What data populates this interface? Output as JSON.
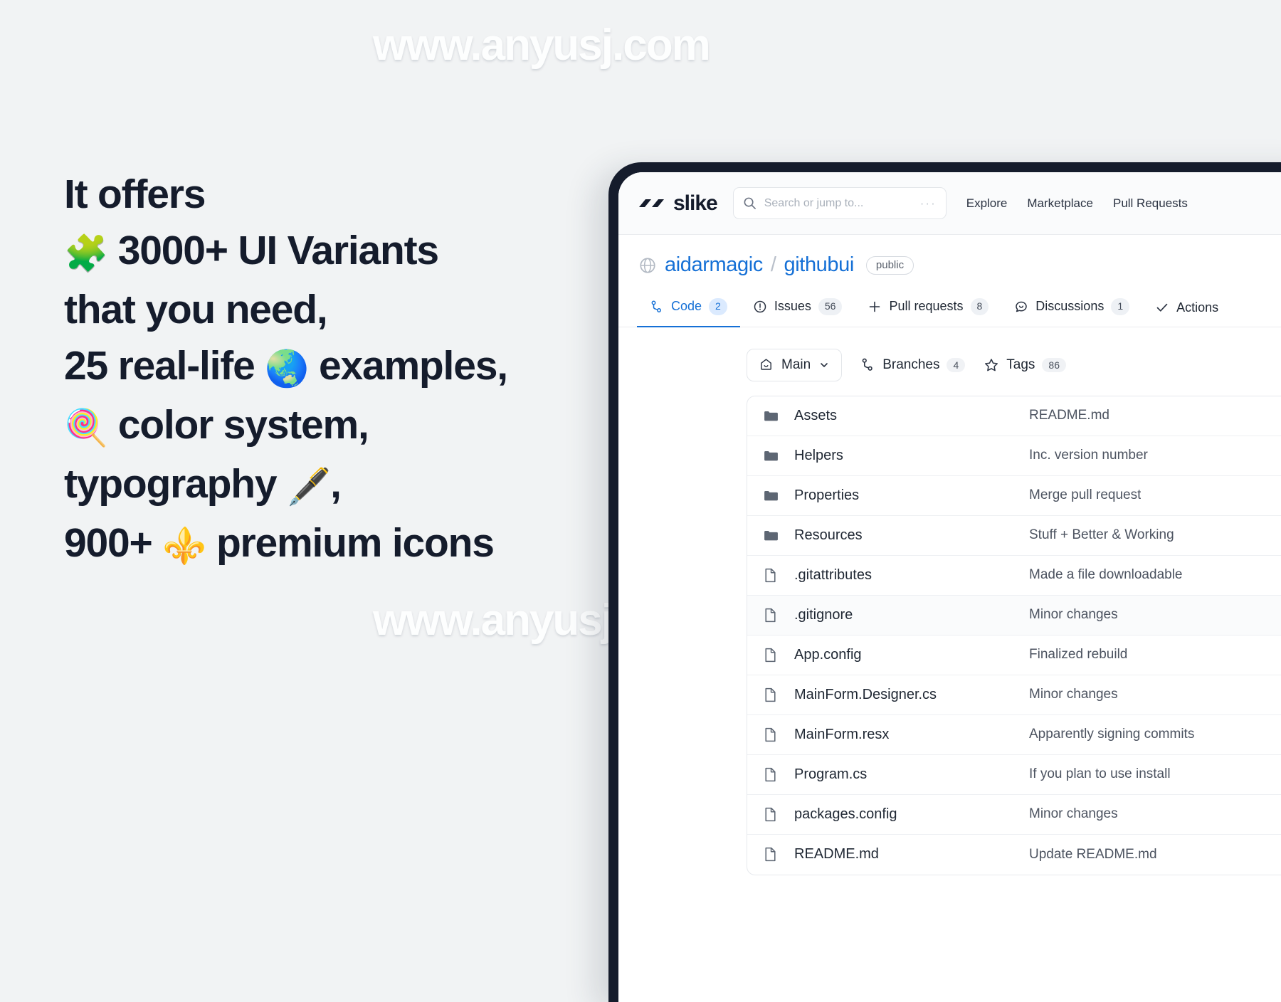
{
  "watermarks": {
    "top": "www.anyusj.com",
    "middle": "www.anyusj.com"
  },
  "marketing_copy": {
    "lines": [
      {
        "text": "It offers",
        "emoji": "",
        "emoji_name": "",
        "emoji_pos": "none",
        "tail": ""
      },
      {
        "text": "3000+ UI Variants",
        "emoji": "🧩",
        "emoji_name": "puzzle-piece-emoji",
        "emoji_pos": "lead",
        "tail": ""
      },
      {
        "text": "that you need,",
        "emoji": "",
        "emoji_name": "",
        "emoji_pos": "none",
        "tail": ""
      },
      {
        "text": "25 real-life",
        "emoji": "🌏",
        "emoji_name": "globe-emoji",
        "emoji_pos": "mid",
        "tail": "examples,"
      },
      {
        "text": "color system,",
        "emoji": "🍭",
        "emoji_name": "lollipop-emoji",
        "emoji_pos": "lead",
        "tail": ""
      },
      {
        "text": "typography",
        "emoji": "🖋️",
        "emoji_name": "fountain-pen-emoji",
        "emoji_pos": "mid",
        "tail": ","
      },
      {
        "text": "900+",
        "emoji": "⚜️",
        "emoji_name": "fleur-de-lis-emoji",
        "emoji_pos": "mid",
        "tail": "premium icons"
      }
    ]
  },
  "app": {
    "brand": {
      "name": "slike"
    },
    "search": {
      "value": "",
      "placeholder": "Search or jump to...",
      "shortcut": "···"
    },
    "nav": [
      {
        "label": "Explore"
      },
      {
        "label": "Marketplace"
      },
      {
        "label": "Pull Requests"
      }
    ],
    "breadcrumb": {
      "owner": "aidarmagic",
      "separator": "/",
      "repo": "githubui",
      "visibility": "public"
    },
    "tabs": [
      {
        "label": "Code",
        "count": "2",
        "icon": "code-branch-icon",
        "active": true
      },
      {
        "label": "Issues",
        "count": "56",
        "icon": "issue-circle-icon",
        "active": false
      },
      {
        "label": "Pull requests",
        "count": "8",
        "icon": "plus-icon",
        "active": false
      },
      {
        "label": "Discussions",
        "count": "1",
        "icon": "comment-icon",
        "active": false
      },
      {
        "label": "Actions",
        "count": "",
        "icon": "check-icon",
        "active": false
      }
    ],
    "branch_bar": {
      "current_branch": "Main",
      "branches_label": "Branches",
      "branches_count": "4",
      "tags_label": "Tags",
      "tags_count": "86"
    },
    "files": [
      {
        "name": "Assets",
        "type": "folder",
        "message": "README.md"
      },
      {
        "name": "Helpers",
        "type": "folder",
        "message": "Inc. version number"
      },
      {
        "name": "Properties",
        "type": "folder",
        "message": "Merge pull request"
      },
      {
        "name": "Resources",
        "type": "folder",
        "message": "Stuff + Better & Working"
      },
      {
        "name": ".gitattributes",
        "type": "file",
        "message": "Made a file downloadable"
      },
      {
        "name": ".gitignore",
        "type": "file",
        "message": "Minor changes"
      },
      {
        "name": "App.config",
        "type": "file",
        "message": "Finalized rebuild"
      },
      {
        "name": "MainForm.Designer.cs",
        "type": "file",
        "message": "Minor changes"
      },
      {
        "name": "MainForm.resx",
        "type": "file",
        "message": "Apparently signing commits"
      },
      {
        "name": "Program.cs",
        "type": "file",
        "message": "If you plan to use install"
      },
      {
        "name": "packages.config",
        "type": "file",
        "message": "Minor changes"
      },
      {
        "name": "README.md",
        "type": "file",
        "message": "Update README.md"
      }
    ]
  },
  "colors": {
    "page_bg": "#f1f3f4",
    "heading": "#151c2c",
    "link_blue": "#1570d6",
    "device_bezel": "#151c2c"
  }
}
